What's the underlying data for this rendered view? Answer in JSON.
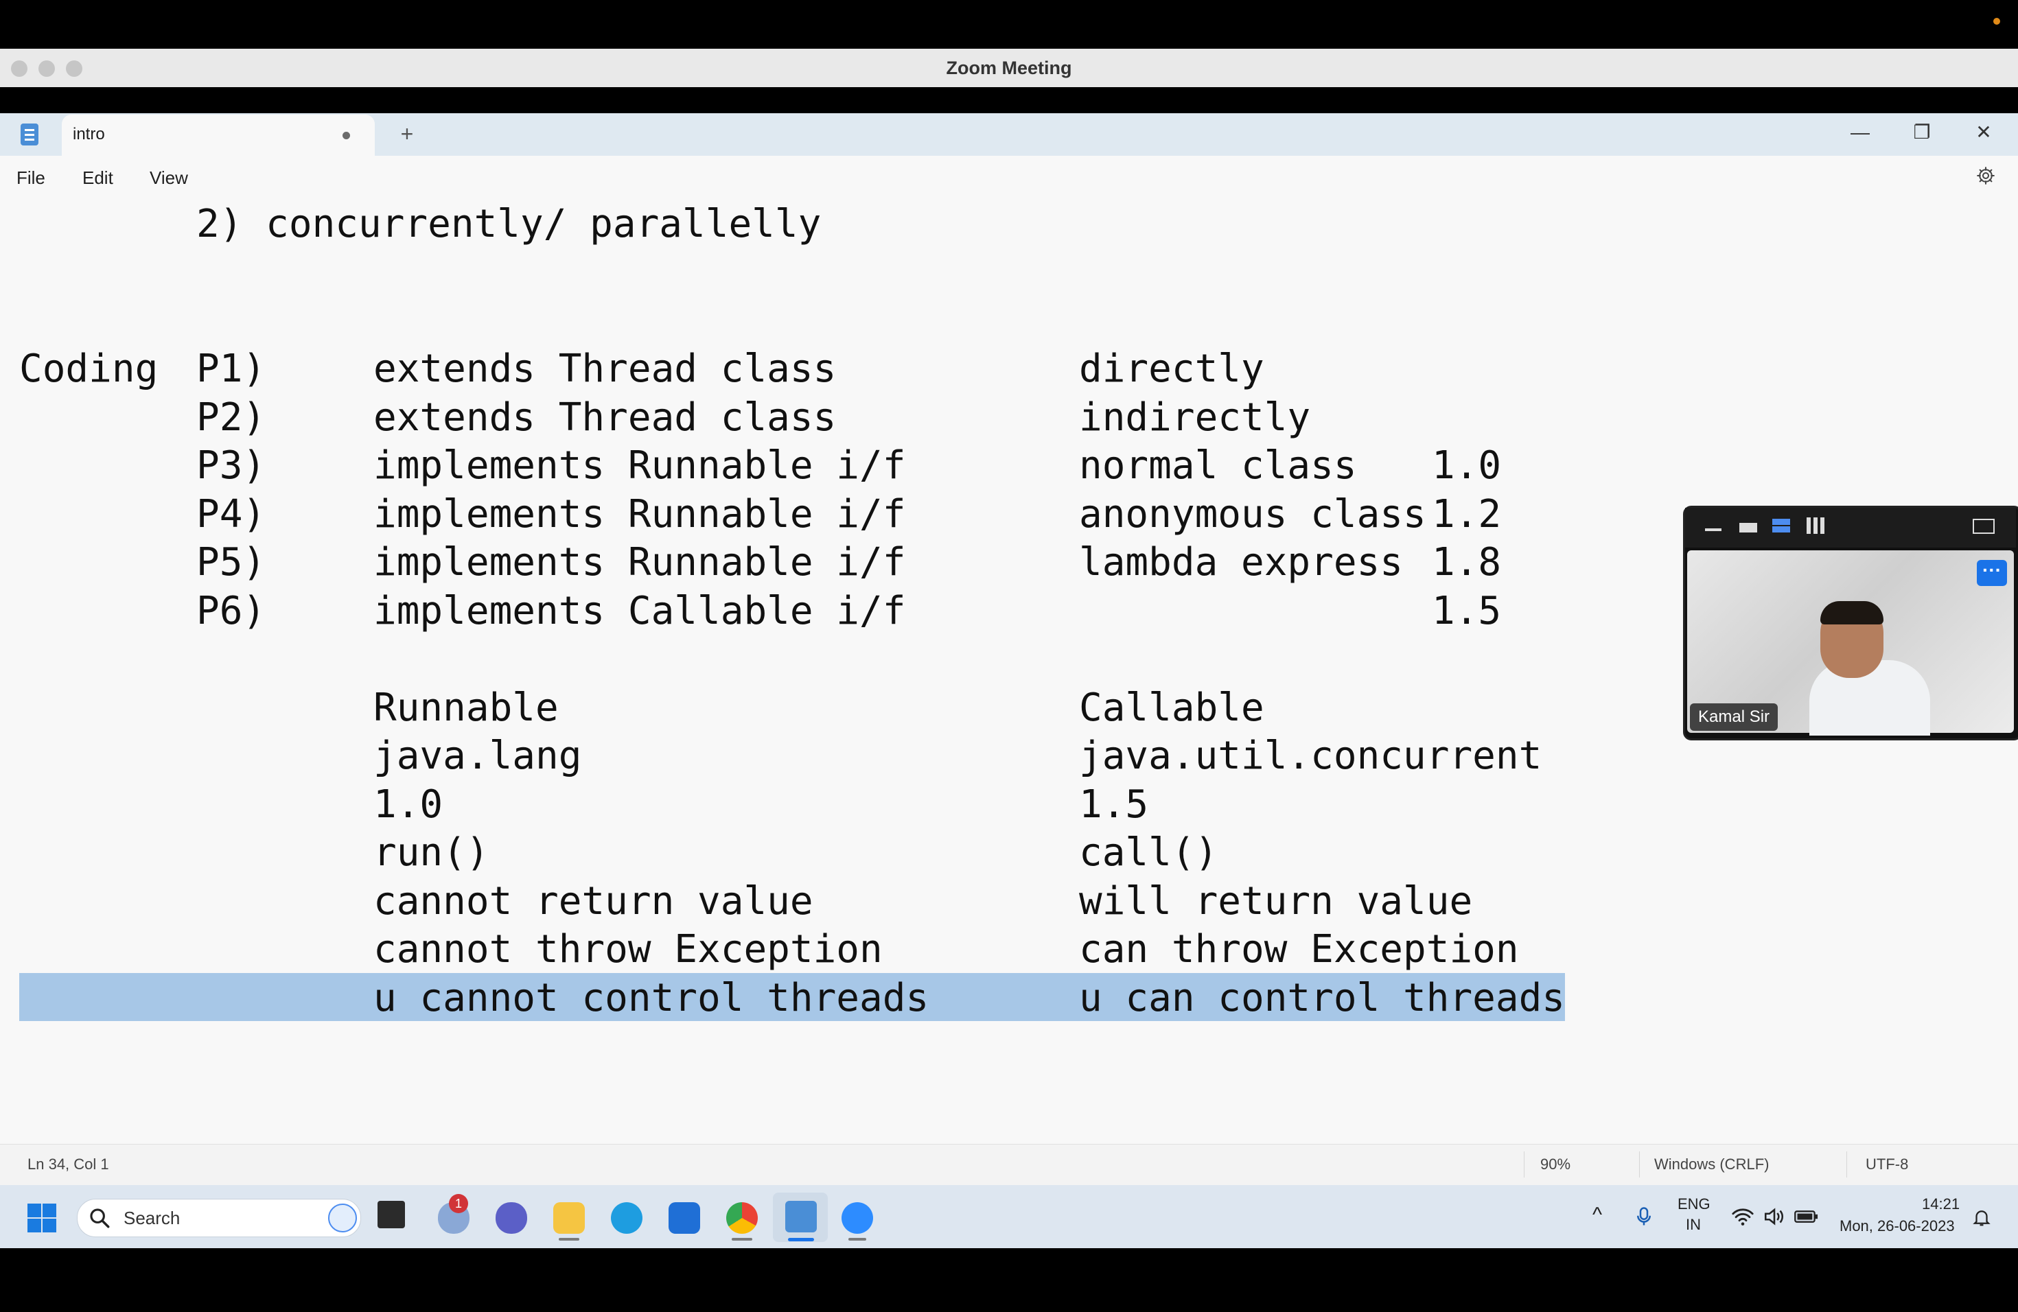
{
  "zoom": {
    "window_title": "Zoom Meeting",
    "participant_name": "Kamal Sir",
    "more_label": "···"
  },
  "notepad": {
    "tab_title": "intro",
    "new_tab_label": "+",
    "window_controls": {
      "minimize": "—",
      "maximize": "❐",
      "close": "✕"
    },
    "menu": [
      "File",
      "Edit",
      "View"
    ],
    "lines": [
      {
        "col0": "",
        "col1": "2) concurrently/ parallelly",
        "col2": "",
        "col3": "",
        "col4": ""
      },
      {
        "col0": "Coding",
        "col1": "P1)",
        "col2": "extends Thread class",
        "col3": "directly",
        "col4": ""
      },
      {
        "col0": "",
        "col1": "P2)",
        "col2": "extends Thread class",
        "col3": "indirectly",
        "col4": ""
      },
      {
        "col0": "",
        "col1": "P3)",
        "col2": "implements Runnable i/f",
        "col3": "normal class",
        "col4": "1.0"
      },
      {
        "col0": "",
        "col1": "P4)",
        "col2": "implements Runnable i/f",
        "col3": "anonymous class",
        "col4": "1.2"
      },
      {
        "col0": "",
        "col1": "P5)",
        "col2": "implements Runnable i/f",
        "col3": "lambda express",
        "col4": "1.8"
      },
      {
        "col0": "",
        "col1": "P6)",
        "col2": "implements Callable i/f",
        "col3": "",
        "col4": "1.5"
      },
      {
        "col0": "",
        "col1": "",
        "col2": "Runnable",
        "col3": "Callable",
        "col4": ""
      },
      {
        "col0": "",
        "col1": "",
        "col2": "java.lang",
        "col3": "java.util.concurrent",
        "col4": ""
      },
      {
        "col0": "",
        "col1": "",
        "col2": "1.0",
        "col3": "1.5",
        "col4": ""
      },
      {
        "col0": "",
        "col1": "",
        "col2": "run()",
        "col3": "call()",
        "col4": ""
      },
      {
        "col0": "",
        "col1": "",
        "col2": "cannot return value",
        "col3": "will return value",
        "col4": ""
      },
      {
        "col0": "",
        "col1": "",
        "col2": "cannot throw Exception",
        "col3": "can throw Exception",
        "col4": ""
      },
      {
        "col0": "",
        "col1": "",
        "col2": "u cannot control threads",
        "col3": "u can control threads",
        "col4": ""
      }
    ],
    "selected_line_index": 13,
    "status": {
      "position": "Ln 34, Col 1",
      "zoom": "90%",
      "line_ending": "Windows (CRLF)",
      "encoding": "UTF-8"
    }
  },
  "taskbar": {
    "search_placeholder": "Search",
    "notification_badge": "1",
    "language_line1": "ENG",
    "language_line2": "IN",
    "time": "14:21",
    "date": "Mon, 26-06-2023",
    "tray_chevron": "^"
  }
}
